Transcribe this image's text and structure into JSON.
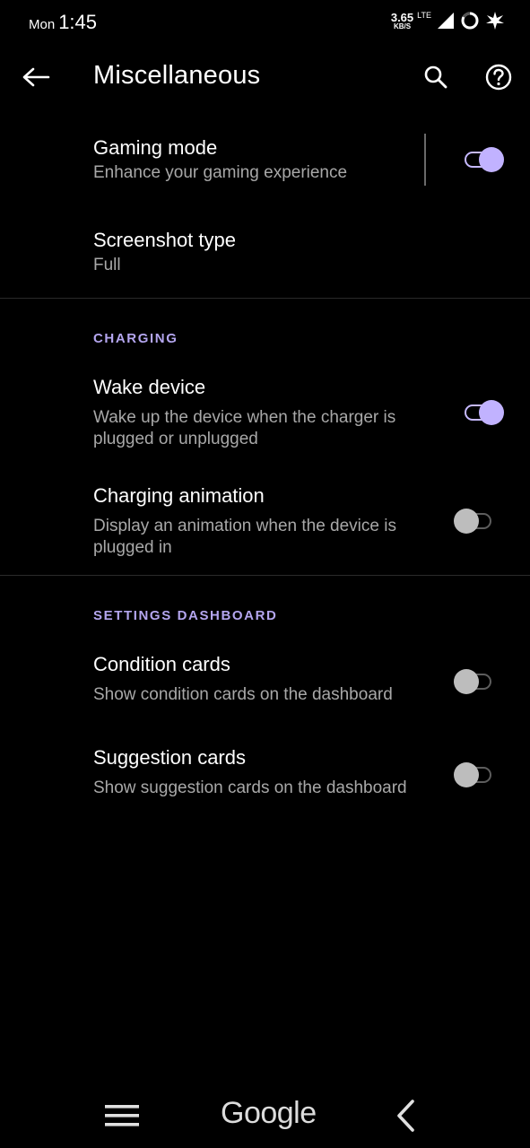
{
  "status_bar": {
    "day": "Mon",
    "time": "1:45",
    "net_speed_value": "3.65",
    "net_speed_unit": "KB/S",
    "network_type": "LTE",
    "icons": [
      "signal-icon",
      "battery-ring-icon",
      "leaf-icon"
    ]
  },
  "toolbar": {
    "title": "Miscellaneous",
    "back_icon": "back-arrow-icon",
    "search_icon": "search-icon",
    "help_icon": "help-icon"
  },
  "items": {
    "gaming_mode": {
      "title": "Gaming mode",
      "summary": "Enhance your gaming experience",
      "enabled": true
    },
    "screenshot_type": {
      "title": "Screenshot type",
      "summary": "Full"
    }
  },
  "sections": {
    "charging": {
      "header": "CHARGING",
      "wake_device": {
        "title": "Wake device",
        "summary": "Wake up the device when the charger is plugged or unplugged",
        "enabled": true
      },
      "charging_animation": {
        "title": "Charging animation",
        "summary": "Display an animation when the device is plugged in",
        "enabled": false
      }
    },
    "dashboard": {
      "header": "SETTINGS DASHBOARD",
      "condition_cards": {
        "title": "Condition cards",
        "summary": "Show condition cards on the dashboard",
        "enabled": false
      },
      "suggestion_cards": {
        "title": "Suggestion cards",
        "summary": "Show suggestion cards on the dashboard",
        "enabled": false
      }
    }
  },
  "nav_bar": {
    "menu_icon": "hamburger-icon",
    "home_label": "Google",
    "back_icon": "chevron-left-icon"
  },
  "colors": {
    "background": "#000000",
    "accent": "#b4a6ef",
    "switch_on": "#c1b2ff",
    "switch_off": "#bdbdbd"
  }
}
